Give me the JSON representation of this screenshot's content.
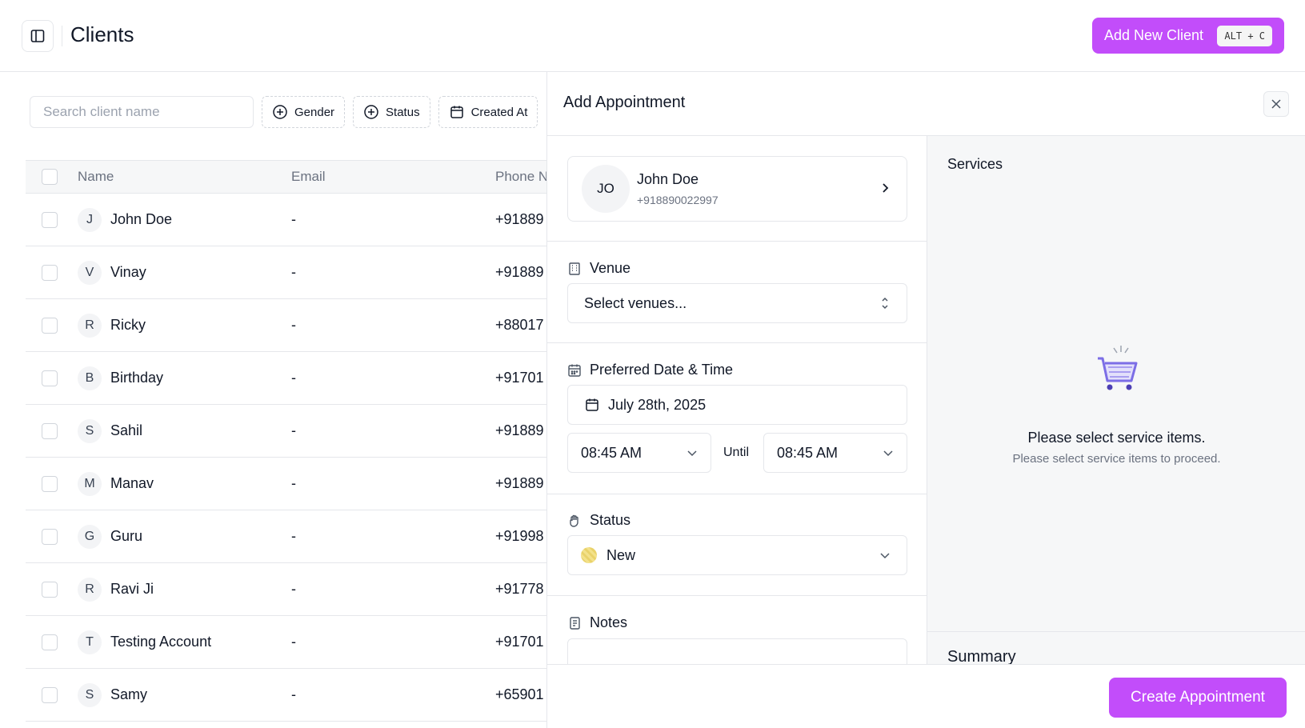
{
  "header": {
    "title": "Clients",
    "add_client_label": "Add New Client",
    "shortcut": "ALT + C"
  },
  "toolbar": {
    "search_placeholder": "Search client name",
    "filters": [
      "Gender",
      "Status",
      "Created At"
    ]
  },
  "table": {
    "columns": [
      "Name",
      "Email",
      "Phone N"
    ],
    "rows": [
      {
        "initial": "J",
        "name": "John Doe",
        "email": "-",
        "phone": "+91889"
      },
      {
        "initial": "V",
        "name": "Vinay",
        "email": "-",
        "phone": "+91889"
      },
      {
        "initial": "R",
        "name": "Ricky",
        "email": "-",
        "phone": "+88017"
      },
      {
        "initial": "B",
        "name": "Birthday",
        "email": "-",
        "phone": "+91701"
      },
      {
        "initial": "S",
        "name": "Sahil",
        "email": "-",
        "phone": "+91889"
      },
      {
        "initial": "M",
        "name": "Manav",
        "email": "-",
        "phone": "+91889"
      },
      {
        "initial": "G",
        "name": "Guru",
        "email": "-",
        "phone": "+91998"
      },
      {
        "initial": "R",
        "name": "Ravi Ji",
        "email": "-",
        "phone": "+91778"
      },
      {
        "initial": "T",
        "name": "Testing Account",
        "email": "-",
        "phone": "+91701"
      },
      {
        "initial": "S",
        "name": "Samy",
        "email": "-",
        "phone": "+65901"
      }
    ]
  },
  "drawer": {
    "title": "Add Appointment",
    "client": {
      "initials": "JO",
      "name": "John Doe",
      "phone": "+918890022997"
    },
    "venue": {
      "label": "Venue",
      "placeholder": "Select venues..."
    },
    "datetime": {
      "label": "Preferred Date & Time",
      "date": "July 28th, 2025",
      "start": "08:45 AM",
      "until": "Until",
      "end": "08:45 AM"
    },
    "status": {
      "label": "Status",
      "value": "New"
    },
    "notes": {
      "label": "Notes"
    },
    "services": {
      "title": "Services",
      "empty_title": "Please select service items.",
      "empty_sub": "Please select service items to proceed."
    },
    "summary": {
      "title": "Summary"
    },
    "create_label": "Create Appointment"
  },
  "colors": {
    "accent": "#c24dfa",
    "cart": "#7c6ee6"
  }
}
